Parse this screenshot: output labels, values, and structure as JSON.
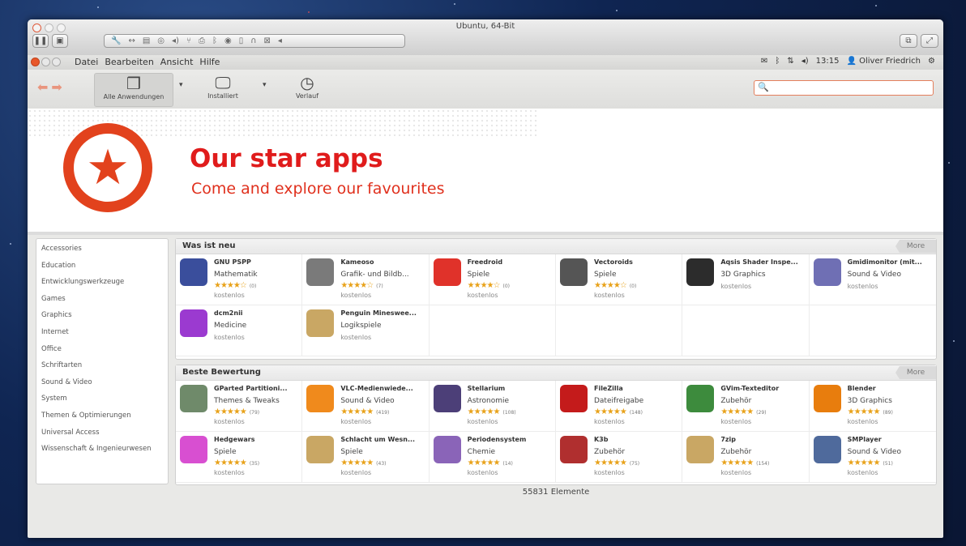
{
  "vm": {
    "title": "Ubuntu, 64-Bit",
    "toolbar_icons": [
      "pause-icon",
      "snapshot-icon",
      "settings-icon",
      "network-icon",
      "disk-icon",
      "camera-icon",
      "audio-icon",
      "usb-icon",
      "printer-icon",
      "bluetooth-icon",
      "cd-icon",
      "floppy-icon",
      "headphones-icon",
      "sharing-icon",
      "arrow-icon"
    ]
  },
  "panel": {
    "menus": [
      "Datei",
      "Bearbeiten",
      "Ansicht",
      "Hilfe"
    ],
    "time": "13:15",
    "user": "Oliver Friedrich"
  },
  "toolbar": {
    "items": [
      {
        "label": "Alle Anwendungen",
        "icon": "box-icon"
      },
      {
        "label": "Installiert",
        "icon": "monitor-icon"
      },
      {
        "label": "Verlauf",
        "icon": "clock-icon"
      }
    ],
    "search_value": ""
  },
  "banner": {
    "title": "Our star apps",
    "subtitle": "Come and explore our favourites",
    "accent": "#e2421d"
  },
  "sidebar": {
    "items": [
      "Accessories",
      "Education",
      "Entwicklungswerkzeuge",
      "Games",
      "Graphics",
      "Internet",
      "Office",
      "Schriftarten",
      "Sound & Video",
      "System",
      "Themen & Optimierungen",
      "Universal Access",
      "Wissenschaft & Ingenieurwesen"
    ]
  },
  "sections": [
    {
      "title": "Was ist neu",
      "more": "More",
      "apps": [
        {
          "name": "GNU PSPP",
          "category": "Mathematik",
          "stars": 4,
          "count": "(0)",
          "price": "kostenlos",
          "icon": "pspp-icon",
          "color": "#3a4e9c"
        },
        {
          "name": "Kameoso",
          "category": "Grafik- und Bildb...",
          "stars": 4,
          "count": "(7)",
          "price": "kostenlos",
          "icon": "webcam-icon",
          "color": "#7a7a7a"
        },
        {
          "name": "Freedroid",
          "category": "Spiele",
          "stars": 4,
          "count": "(0)",
          "price": "kostenlos",
          "icon": "freedroid-icon",
          "color": "#e0322a"
        },
        {
          "name": "Vectoroids",
          "category": "Spiele",
          "stars": 4,
          "count": "(0)",
          "price": "kostenlos",
          "icon": "asteroid-icon",
          "color": "#555555"
        },
        {
          "name": "Aqsis Shader Inspe...",
          "category": "3D Graphics",
          "stars": 0,
          "count": "",
          "price": "kostenlos",
          "icon": "aqsis-icon",
          "color": "#2c2c2c"
        },
        {
          "name": "Gmidimonitor (mit...",
          "category": "Sound & Video",
          "stars": 0,
          "count": "",
          "price": "kostenlos",
          "icon": "midi-icon",
          "color": "#6f6fb4"
        },
        {
          "name": "dcm2nii",
          "category": "Medicine",
          "stars": 0,
          "count": "",
          "price": "kostenlos",
          "icon": "brain-icon",
          "color": "#9b3ad0"
        },
        {
          "name": "Penguin Mineswee...",
          "category": "Logikspiele",
          "stars": 0,
          "count": "",
          "price": "kostenlos",
          "icon": "package-icon",
          "color": "#c9a764"
        },
        {
          "name": "",
          "category": "",
          "stars": 0,
          "count": "",
          "price": "",
          "icon": "",
          "color": ""
        },
        {
          "name": "",
          "category": "",
          "stars": 0,
          "count": "",
          "price": "",
          "icon": "",
          "color": ""
        },
        {
          "name": "",
          "category": "",
          "stars": 0,
          "count": "",
          "price": "",
          "icon": "",
          "color": ""
        },
        {
          "name": "",
          "category": "",
          "stars": 0,
          "count": "",
          "price": "",
          "icon": "",
          "color": ""
        }
      ]
    },
    {
      "title": "Beste Bewertung",
      "more": "More",
      "apps": [
        {
          "name": "GParted Partitioni...",
          "category": "Themes & Tweaks",
          "stars": 5,
          "count": "(79)",
          "price": "kostenlos",
          "icon": "harddisk-icon",
          "color": "#6f8a6a"
        },
        {
          "name": "VLC-Medienwiede...",
          "category": "Sound & Video",
          "stars": 5,
          "count": "(419)",
          "price": "kostenlos",
          "icon": "cone-icon",
          "color": "#f08a1c"
        },
        {
          "name": "Stellarium",
          "category": "Astronomie",
          "stars": 5,
          "count": "(108)",
          "price": "kostenlos",
          "icon": "stellarium-icon",
          "color": "#4c3f78"
        },
        {
          "name": "FileZilla",
          "category": "Dateifreigabe",
          "stars": 5,
          "count": "(148)",
          "price": "kostenlos",
          "icon": "filezilla-icon",
          "color": "#c41b1b"
        },
        {
          "name": "GVim-Texteditor",
          "category": "Zubehör",
          "stars": 5,
          "count": "(29)",
          "price": "kostenlos",
          "icon": "vim-icon",
          "color": "#3d8b3d"
        },
        {
          "name": "Blender",
          "category": "3D Graphics",
          "stars": 5,
          "count": "(89)",
          "price": "kostenlos",
          "icon": "blender-icon",
          "color": "#e87d0d"
        },
        {
          "name": "Hedgewars",
          "category": "Spiele",
          "stars": 5,
          "count": "(35)",
          "price": "kostenlos",
          "icon": "hedgehog-icon",
          "color": "#d84fd1"
        },
        {
          "name": "Schlacht um Wesn...",
          "category": "Spiele",
          "stars": 5,
          "count": "(43)",
          "price": "kostenlos",
          "icon": "package-icon",
          "color": "#c9a764"
        },
        {
          "name": "Periodensystem",
          "category": "Chemie",
          "stars": 5,
          "count": "(14)",
          "price": "kostenlos",
          "icon": "flask-icon",
          "color": "#8a64b8"
        },
        {
          "name": "K3b",
          "category": "Zubehör",
          "stars": 5,
          "count": "(75)",
          "price": "kostenlos",
          "icon": "k3b-icon",
          "color": "#b02f2f"
        },
        {
          "name": "7zip",
          "category": "Zubehör",
          "stars": 5,
          "count": "(154)",
          "price": "kostenlos",
          "icon": "package-icon",
          "color": "#c9a764"
        },
        {
          "name": "SMPlayer",
          "category": "Sound & Video",
          "stars": 5,
          "count": "(51)",
          "price": "kostenlos",
          "icon": "smplayer-icon",
          "color": "#4f6a9c"
        }
      ]
    }
  ],
  "status": {
    "count_text": "55831 Elemente"
  }
}
